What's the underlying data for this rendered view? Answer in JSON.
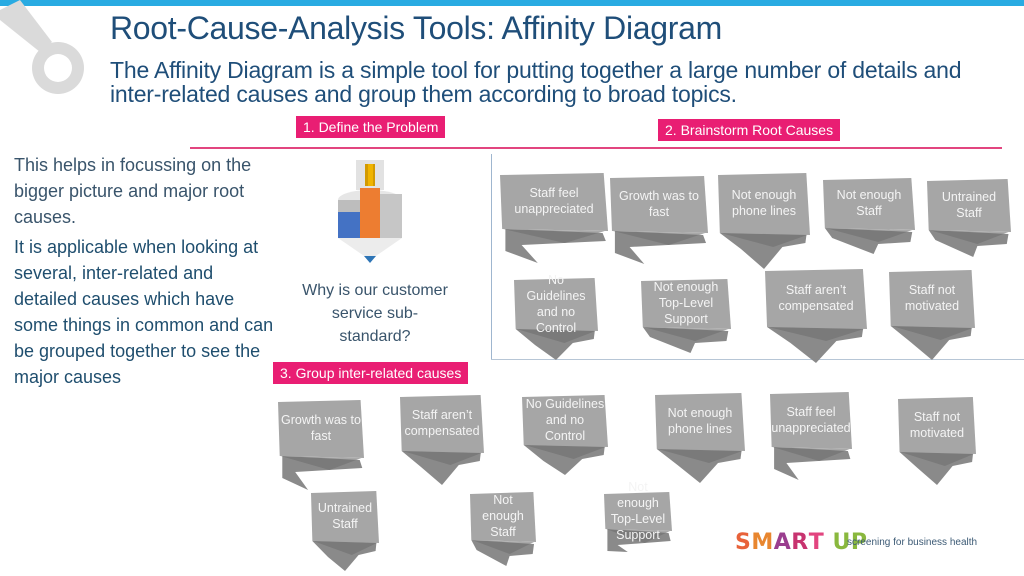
{
  "header": {
    "title": "Root-Cause-Analysis Tools: Affinity Diagram",
    "subtitle": "The Affinity Diagram is a simple tool for putting together a large number of details and inter-related causes and group them according to broad topics."
  },
  "steps": {
    "define": "1. Define the Problem",
    "brainstorm": "2. Brainstorm Root Causes",
    "group": "3. Group inter-related causes"
  },
  "left_text": {
    "intro": "This helps in focussing on the bigger picture and major root causes.",
    "applicability": "It is applicable when looking at several, inter-related and detailed causes which have some things in common and can be grouped together to see the major causes"
  },
  "problem": {
    "icon": "pencil-icon",
    "question": "Why is our customer service sub-standard?"
  },
  "brainstorm_cards": [
    {
      "label": "Staff feel unappreciated"
    },
    {
      "label": "Growth was to fast"
    },
    {
      "label": "Not enough phone lines"
    },
    {
      "label": "Not enough Staff"
    },
    {
      "label": "Untrained Staff"
    },
    {
      "label": "No Guidelines and no Control"
    },
    {
      "label": "Not enough Top-Level Support"
    },
    {
      "label": "Staff aren’t compensated"
    },
    {
      "label": "Staff not motivated"
    }
  ],
  "grouped_cards": [
    {
      "label": "Growth was to fast"
    },
    {
      "label": "Staff aren’t compensated"
    },
    {
      "label": "No Guidelines and no Control"
    },
    {
      "label": "Not enough phone lines"
    },
    {
      "label": "Staff feel unappreciated"
    },
    {
      "label": "Staff not motivated"
    },
    {
      "label": "Untrained Staff"
    },
    {
      "label": "Not enough Staff"
    },
    {
      "label": "Not enough Top-Level Support"
    }
  ],
  "branding": {
    "logo_letters": [
      "S",
      "M",
      "A",
      "R",
      "T",
      " ",
      "U",
      "P"
    ],
    "logo_colors": [
      "#e8623a",
      "#e8862f",
      "#9a3e8f",
      "#c7336f",
      "#e2457f",
      "#ffffff",
      "#8ab83e",
      "#8ab83e"
    ],
    "tagline": "screening for business health"
  },
  "colors": {
    "accent": "#e91e73",
    "title": "#1f4e79",
    "card": "#a6a6a6",
    "card_shadow": "#7f7f7f"
  }
}
